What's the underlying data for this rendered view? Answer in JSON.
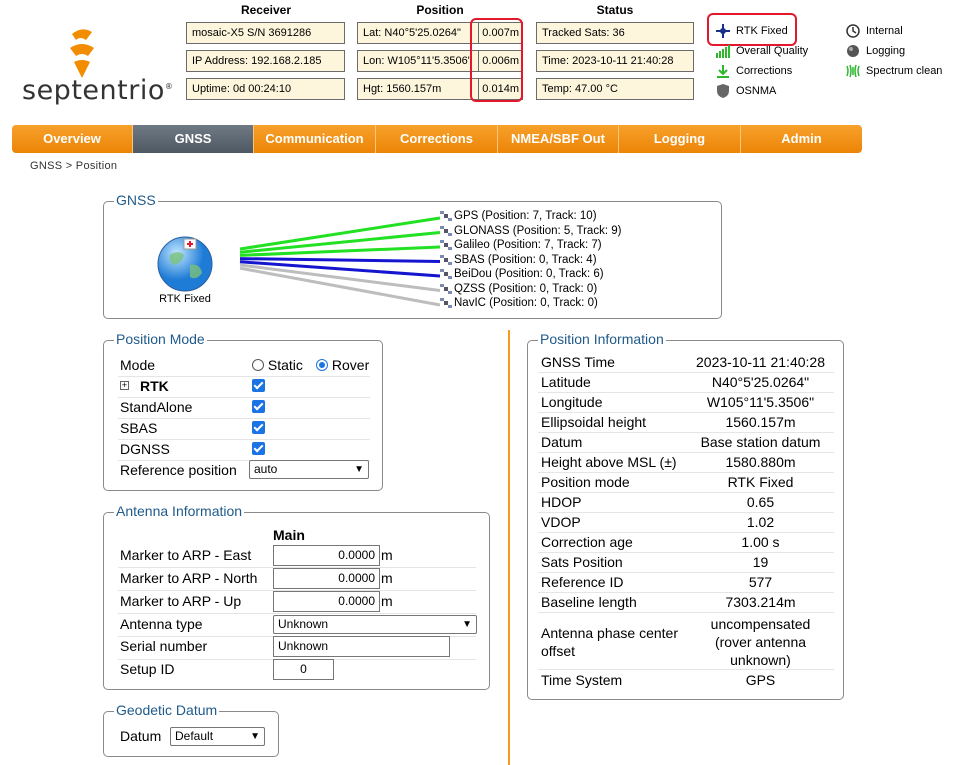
{
  "header": {
    "logo": "septentrio",
    "receiver_title": "Receiver",
    "position_title": "Position",
    "status_title": "Status",
    "receiver": [
      "mosaic-X5 S/N 3691286",
      "IP Address: 192.168.2.185",
      "Uptime: 0d 00:24:10"
    ],
    "position": [
      {
        "label": "Lat:  N40°5'25.0264\"",
        "acc": "0.007m"
      },
      {
        "label": "Lon: W105°11'5.3506\"",
        "acc": "0.006m"
      },
      {
        "label": "Hgt: 1560.157m",
        "acc": "0.014m"
      }
    ],
    "status": [
      "Tracked Sats: 36",
      "Time: 2023-10-11 21:40:28",
      "Temp: 47.00 °C"
    ],
    "indicators": {
      "rtk_fixed": "RTK Fixed",
      "overall_quality": "Overall Quality",
      "corrections": "Corrections",
      "osnma": "OSNMA",
      "internal": "Internal",
      "logging": "Logging",
      "spectrum": "Spectrum clean"
    }
  },
  "nav": [
    "Overview",
    "GNSS",
    "Communication",
    "Corrections",
    "NMEA/SBF Out",
    "Logging",
    "Admin"
  ],
  "breadcrumb": "GNSS > Position",
  "gnss": {
    "legend": "GNSS",
    "globe_label": "RTK Fixed",
    "constellations": [
      {
        "text": "GPS (Position: 7, Track: 10)",
        "color": "#22e022"
      },
      {
        "text": "GLONASS (Position: 5, Track: 9)",
        "color": "#22e022"
      },
      {
        "text": "Galileo (Position: 7, Track: 7)",
        "color": "#22e022"
      },
      {
        "text": "SBAS (Position: 0, Track: 4)",
        "color": "#1515d0"
      },
      {
        "text": "BeiDou (Position: 0, Track: 6)",
        "color": "#1515d0"
      },
      {
        "text": "QZSS (Position: 0, Track: 0)",
        "color": "#bdbdbd"
      },
      {
        "text": "NavIC (Position: 0, Track: 0)",
        "color": "#bdbdbd"
      }
    ]
  },
  "position_mode": {
    "legend": "Position Mode",
    "mode_label": "Mode",
    "static": "Static",
    "rover": "Rover",
    "rtk": "RTK",
    "standalone": "StandAlone",
    "sbas": "SBAS",
    "dgnss": "DGNSS",
    "ref_label": "Reference position",
    "ref_value": "auto"
  },
  "antenna": {
    "legend": "Antenna Information",
    "main": "Main",
    "east_label": "Marker to ARP - East",
    "east_value": "0.0000",
    "north_label": "Marker to ARP - North",
    "north_value": "0.0000",
    "up_label": "Marker to ARP - Up",
    "up_value": "0.0000",
    "unit": "m",
    "type_label": "Antenna type",
    "type_value": "Unknown",
    "serial_label": "Serial number",
    "serial_value": "Unknown",
    "setup_label": "Setup ID",
    "setup_value": "0"
  },
  "datum": {
    "legend": "Geodetic Datum",
    "label": "Datum",
    "value": "Default"
  },
  "position_info": {
    "legend": "Position Information",
    "rows": [
      {
        "label": "GNSS Time",
        "value": "2023-10-11 21:40:28"
      },
      {
        "label": "Latitude",
        "value": "N40°5'25.0264\""
      },
      {
        "label": "Longitude",
        "value": "W105°11'5.3506\""
      },
      {
        "label": "Ellipsoidal height",
        "value": "1560.157m"
      },
      {
        "label": "Datum",
        "value": "Base station datum"
      },
      {
        "label": "Height above MSL (±)",
        "value": "1580.880m"
      },
      {
        "label": "Position mode",
        "value": "RTK Fixed"
      },
      {
        "label": "HDOP",
        "value": "0.65"
      },
      {
        "label": "VDOP",
        "value": "1.02"
      },
      {
        "label": "Correction age",
        "value": "1.00 s"
      },
      {
        "label": "Sats Position",
        "value": "19"
      },
      {
        "label": "Reference ID",
        "value": "577"
      },
      {
        "label": "Baseline length",
        "value": "7303.214m"
      }
    ],
    "phase_label_1": "Antenna phase center",
    "phase_label_2": "offset",
    "phase_value_1": "uncompensated",
    "phase_value_2": "(rover antenna",
    "phase_value_3": "unknown)",
    "time_system_label": "Time System",
    "time_system_value": "GPS"
  }
}
